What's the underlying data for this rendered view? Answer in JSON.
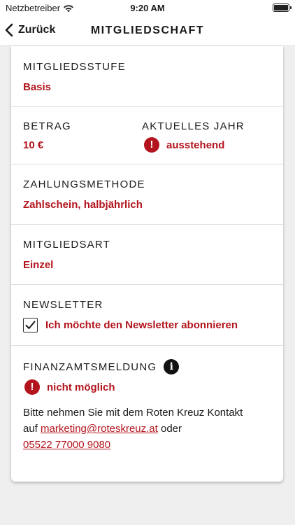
{
  "status_bar": {
    "carrier": "Netzbetreiber",
    "time": "9:20 AM"
  },
  "nav": {
    "back_label": "Zurück",
    "title": "MITGLIEDSCHAFT"
  },
  "membership_level": {
    "label": "MITGLIEDSSTUFE",
    "value": "Basis"
  },
  "amount": {
    "label": "BETRAG",
    "value": "10 €"
  },
  "current_year": {
    "label": "AKTUELLES JAHR",
    "value": "ausstehend"
  },
  "payment_method": {
    "label": "ZAHLUNGSMETHODE",
    "value": "Zahlschein, halbjährlich"
  },
  "membership_type": {
    "label": "MITGLIEDSART",
    "value": "Einzel"
  },
  "newsletter": {
    "label": "NEWSLETTER",
    "checkbox_label": "Ich möchte den Newsletter abonnieren",
    "checked": true
  },
  "tax_report": {
    "label": "FINANZAMTSMELDUNG",
    "status": "nicht möglich",
    "text_line1": "Bitte nehmen Sie mit dem Roten Kreuz Kontakt",
    "text_prefix": "auf",
    "email": "marketing@roteskreuz.at",
    "text_or": "oder",
    "phone": "05522 77000 9080"
  },
  "icons": {
    "back": "chevron-left-icon",
    "alert": "exclamation-circle-icon",
    "info": "info-circle-icon",
    "check": "checkmark-icon",
    "wifi": "wifi-icon",
    "battery": "battery-icon"
  },
  "colors": {
    "accent": "#b3141d",
    "background": "#efeff0",
    "card": "#ffffff"
  }
}
